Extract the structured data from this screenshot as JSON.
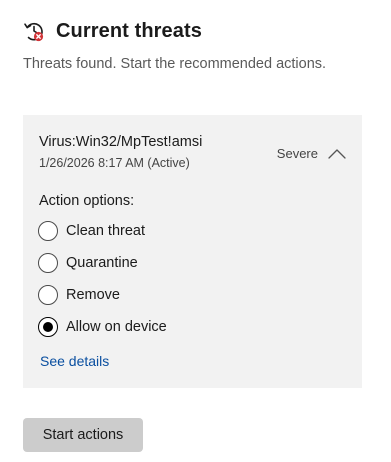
{
  "header": {
    "title": "Current threats",
    "icon": "threat-history-icon"
  },
  "subtitle": "Threats found. Start the recommended actions.",
  "threat": {
    "name": "Virus:Win32/MpTest!amsi",
    "date": "1/26/2026 8:17 AM (Active)",
    "severity": "Severe",
    "expanded": true,
    "action_title": "Action options:",
    "options": [
      {
        "label": "Clean threat",
        "selected": false
      },
      {
        "label": "Quarantine",
        "selected": false
      },
      {
        "label": "Remove",
        "selected": false
      },
      {
        "label": "Allow on device",
        "selected": true
      }
    ],
    "see_details": "See details"
  },
  "start_button": "Start actions",
  "colors": {
    "link": "#0a4fa0",
    "card_bg": "#f2f2f2",
    "button_bg": "#cccccc",
    "alert_red": "#d13438"
  }
}
